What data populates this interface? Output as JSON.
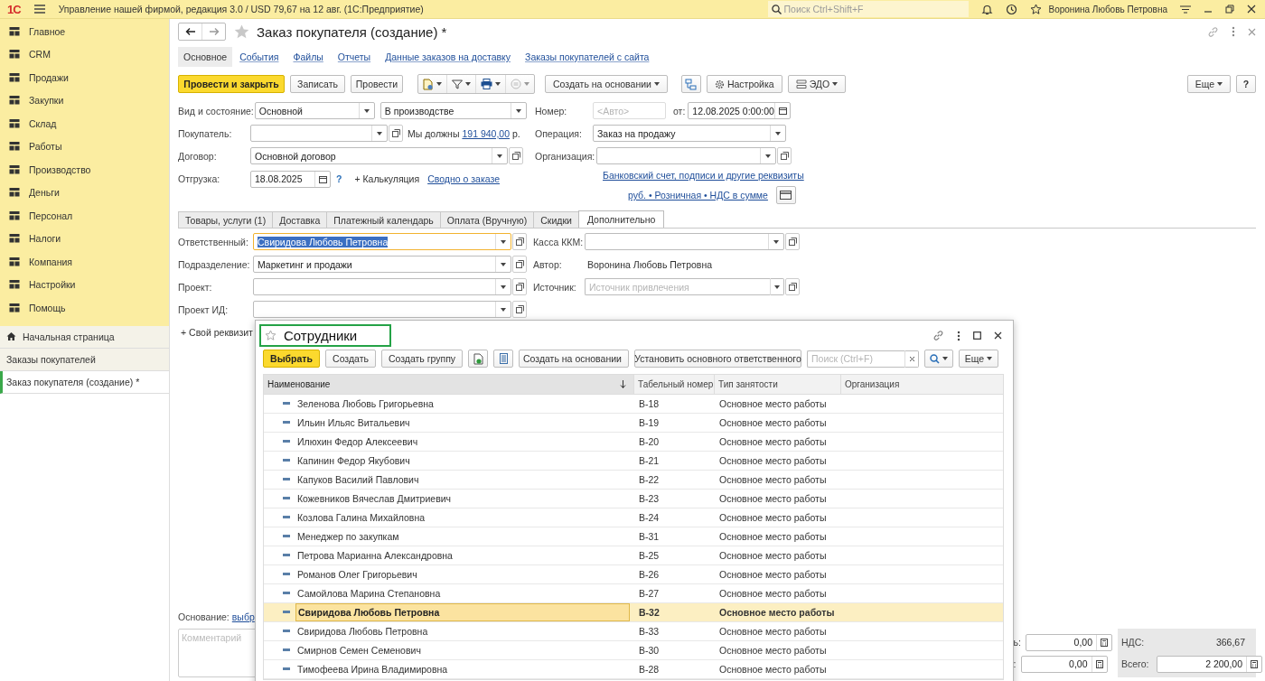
{
  "app_bar": {
    "logo": "1С",
    "title": "Управление нашей фирмой, редакция 3.0 / USD 79,67 на 12 авг.  (1С:Предприятие)",
    "search_placeholder": "Поиск Ctrl+Shift+F",
    "user": "Воронина Любовь Петровна"
  },
  "sidebar": {
    "sections": [
      {
        "label": "Главное"
      },
      {
        "label": "CRM"
      },
      {
        "label": "Продажи"
      },
      {
        "label": "Закупки"
      },
      {
        "label": "Склад"
      },
      {
        "label": "Работы"
      },
      {
        "label": "Производство"
      },
      {
        "label": "Деньги"
      },
      {
        "label": "Персонал"
      },
      {
        "label": "Налоги"
      },
      {
        "label": "Компания"
      },
      {
        "label": "Настройки"
      },
      {
        "label": "Помощь"
      }
    ],
    "open_windows": [
      {
        "label": "Начальная страница",
        "kind": "home",
        "selected": false
      },
      {
        "label": "Заказы покупателей",
        "kind": "list",
        "selected": false
      },
      {
        "label": "Заказ покупателя (создание) *",
        "kind": "list",
        "selected": true
      }
    ]
  },
  "form": {
    "title": "Заказ покупателя (создание) *",
    "nav": [
      {
        "label": "Основное",
        "selected": true
      },
      {
        "label": "События",
        "selected": false
      },
      {
        "label": "Файлы",
        "selected": false
      },
      {
        "label": "Отчеты",
        "selected": false
      },
      {
        "label": "Данные заказов на доставку",
        "selected": false
      },
      {
        "label": "Заказы покупателей с сайта",
        "selected": false
      }
    ],
    "toolbar": {
      "primary": "Провести и закрыть",
      "buttons": [
        "Записать",
        "Провести"
      ],
      "create_based": "Создать на основании",
      "settings": "Настройка",
      "edo": "ЭДО",
      "more": "Еще",
      "help": "?"
    },
    "fields": {
      "kind_state": {
        "label": "Вид и состояние:",
        "kind": "Основной",
        "state": "В производстве"
      },
      "customer": {
        "label": "Покупатель:",
        "debt_text": "Мы должны",
        "debt_amount": "191 940,00",
        "currency": "р."
      },
      "contract": {
        "label": "Договор:",
        "value": "Основной договор"
      },
      "shipment": {
        "label": "Отгрузка:",
        "value": "18.08.2025",
        "help": "?",
        "calc": "+ Калькуляция",
        "summary_link": "Сводно о заказе"
      },
      "number": {
        "label": "Номер:",
        "placeholder": "<Авто>",
        "date_label": "от:",
        "date": "12.08.2025  0:00:00"
      },
      "operation": {
        "label": "Операция:",
        "value": "Заказ на продажу"
      },
      "organization": {
        "label": "Организация:"
      },
      "bank_link": "Банковский счет, подписи и другие реквизиты",
      "price_link": "руб. • Розничная • НДС в сумме"
    },
    "tabs": [
      {
        "label": "Товары, услуги (1)",
        "selected": false
      },
      {
        "label": "Доставка",
        "selected": false
      },
      {
        "label": "Платежный календарь",
        "selected": false
      },
      {
        "label": "Оплата (Вручную)",
        "selected": false
      },
      {
        "label": "Скидки",
        "selected": false
      },
      {
        "label": "Дополнительно",
        "selected": true
      }
    ],
    "extra": {
      "responsible": {
        "label": "Ответственный:",
        "value": "Свиридова Любовь Петровна",
        "focused": true
      },
      "department": {
        "label": "Подразделение:",
        "value": "Маркетинг и продажи"
      },
      "project": {
        "label": "Проект:"
      },
      "project_id": {
        "label": "Проект ИД:"
      },
      "add_attribute": "+ Свой реквизит",
      "cash_register": {
        "label": "Касса ККМ:"
      },
      "author": {
        "label": "Автор:",
        "value": "Воронина Любовь Петровна"
      },
      "source": {
        "label": "Источник:",
        "placeholder": "Источник привлечения"
      }
    },
    "basis": {
      "label": "Основание:",
      "link": "выбр"
    },
    "comment": {
      "placeholder": "Комментарий"
    },
    "totals": [
      {
        "label": "ь:",
        "value": "0,00"
      },
      {
        "label": ":",
        "value": "0,00"
      }
    ],
    "vat": {
      "label": "НДС:",
      "value": "366,67"
    },
    "total": {
      "label": "Всего:",
      "value": "2 200,00"
    }
  },
  "popup": {
    "title": "Сотрудники",
    "toolbar": {
      "choose": "Выбрать",
      "create": "Создать",
      "create_group": "Создать группу",
      "create_based": "Создать на основании",
      "set_responsible": "Установить основного ответственного",
      "search_placeholder": "Поиск (Ctrl+F)",
      "more": "Еще"
    },
    "columns": [
      {
        "label": "Наименование",
        "sorted": true
      },
      {
        "label": "Табельный номер",
        "sorted": false
      },
      {
        "label": "Тип занятости",
        "sorted": false
      },
      {
        "label": "Организация",
        "sorted": false
      }
    ],
    "rows": [
      {
        "name": "Зеленова Любовь Григорьевна",
        "number": "В-18",
        "employment": "Основное место работы",
        "selected": false
      },
      {
        "name": "Ильин Ильяс Витальевич",
        "number": "В-19",
        "employment": "Основное место работы",
        "selected": false
      },
      {
        "name": "Илюхин Федор Алексеевич",
        "number": "В-20",
        "employment": "Основное место работы",
        "selected": false
      },
      {
        "name": "Капинин Федор Якубович",
        "number": "В-21",
        "employment": "Основное место работы",
        "selected": false
      },
      {
        "name": "Капуков Василий Павлович",
        "number": "В-22",
        "employment": "Основное место работы",
        "selected": false
      },
      {
        "name": "Кожевников Вячеслав Дмитриевич",
        "number": "В-23",
        "employment": "Основное место работы",
        "selected": false
      },
      {
        "name": "Козлова Галина Михайловна",
        "number": "В-24",
        "employment": "Основное место работы",
        "selected": false
      },
      {
        "name": "Менеджер по закупкам",
        "number": "В-31",
        "employment": "Основное место работы",
        "selected": false
      },
      {
        "name": "Петрова Марианна Александровна",
        "number": "В-25",
        "employment": "Основное место работы",
        "selected": false
      },
      {
        "name": "Романов Олег Григорьевич",
        "number": "В-26",
        "employment": "Основное место работы",
        "selected": false
      },
      {
        "name": "Самойлова Марина Степановна",
        "number": "В-27",
        "employment": "Основное место работы",
        "selected": false
      },
      {
        "name": "Свиридова Любовь Петровна",
        "number": "В-32",
        "employment": "Основное место работы",
        "selected": true
      },
      {
        "name": "Свиридова Любовь Петровна",
        "number": "В-33",
        "employment": "Основное место работы",
        "selected": false
      },
      {
        "name": "Смирнов Семен Семенович",
        "number": "В-30",
        "employment": "Основное место работы",
        "selected": false
      },
      {
        "name": "Тимофеева Ирина Владимировна",
        "number": "В-28",
        "employment": "Основное место работы",
        "selected": false
      }
    ]
  }
}
